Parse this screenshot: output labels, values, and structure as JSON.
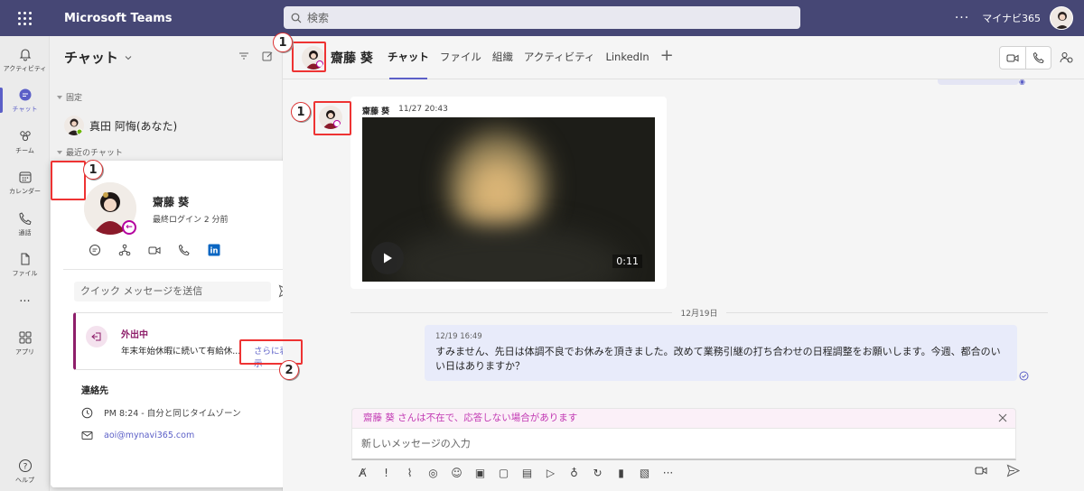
{
  "topbar": {
    "title": "Microsoft Teams",
    "search_placeholder": "検索",
    "more": "···",
    "user": "マイナビ365"
  },
  "rail": [
    {
      "label": "アクティビティ",
      "icon": "bell-icon"
    },
    {
      "label": "チャット",
      "icon": "chat-icon"
    },
    {
      "label": "チーム",
      "icon": "teams-icon"
    },
    {
      "label": "カレンダー",
      "icon": "calendar-icon"
    },
    {
      "label": "通話",
      "icon": "phone-icon"
    },
    {
      "label": "ファイル",
      "icon": "file-icon"
    },
    {
      "label": "···",
      "icon": "more-icon"
    },
    {
      "label": "アプリ",
      "icon": "apps-icon"
    },
    {
      "label": "ヘルプ",
      "icon": "help-icon"
    }
  ],
  "chatlist": {
    "title": "チャット",
    "pinned_label": "固定",
    "pinned_items": [
      {
        "name": "真田 阿悔(あなた)"
      }
    ],
    "recent_label": "最近のチャット"
  },
  "profile_card": {
    "name": "齋藤 葵",
    "status": "最終ログイン 2 分前",
    "quick_message_placeholder": "クイック メッセージを送信",
    "ooo_title": "外出中",
    "ooo_text": "年末年始休暇に続いて有給休...",
    "ooo_more": "さらに表示",
    "contact_title": "連絡先",
    "time_text": "PM 8:24 - 自分と同じタイムゾーン",
    "email": "aoi@mynavi365.com"
  },
  "conversation": {
    "name": "齋藤 葵",
    "tabs": [
      "チャット",
      "ファイル",
      "組織",
      "アクティビティ",
      "LinkedIn"
    ],
    "tab_add": "+",
    "messages": [
      {
        "sender": "齋藤 葵",
        "time": "11/27 20:43",
        "video_duration": "0:11"
      }
    ],
    "date_divider": "12月19日",
    "my_message": {
      "time": "12/19 16:49",
      "text": "すみません、先日は体調不良でお休みを頂きました。改めて業務引継の打ち合わせの日程調整をお願いします。今週、都合のいい日はありますか？"
    },
    "away_banner": "齋藤 葵 さんは不在で、応答しない場合があります",
    "compose_placeholder": "新しいメッセージの入力"
  },
  "annotations": {
    "one": "1",
    "two": "2"
  },
  "colors": {
    "brand": "#464775",
    "accent": "#5b5fc7",
    "ooo": "#8e1e6a",
    "annotation": "#e33333"
  }
}
